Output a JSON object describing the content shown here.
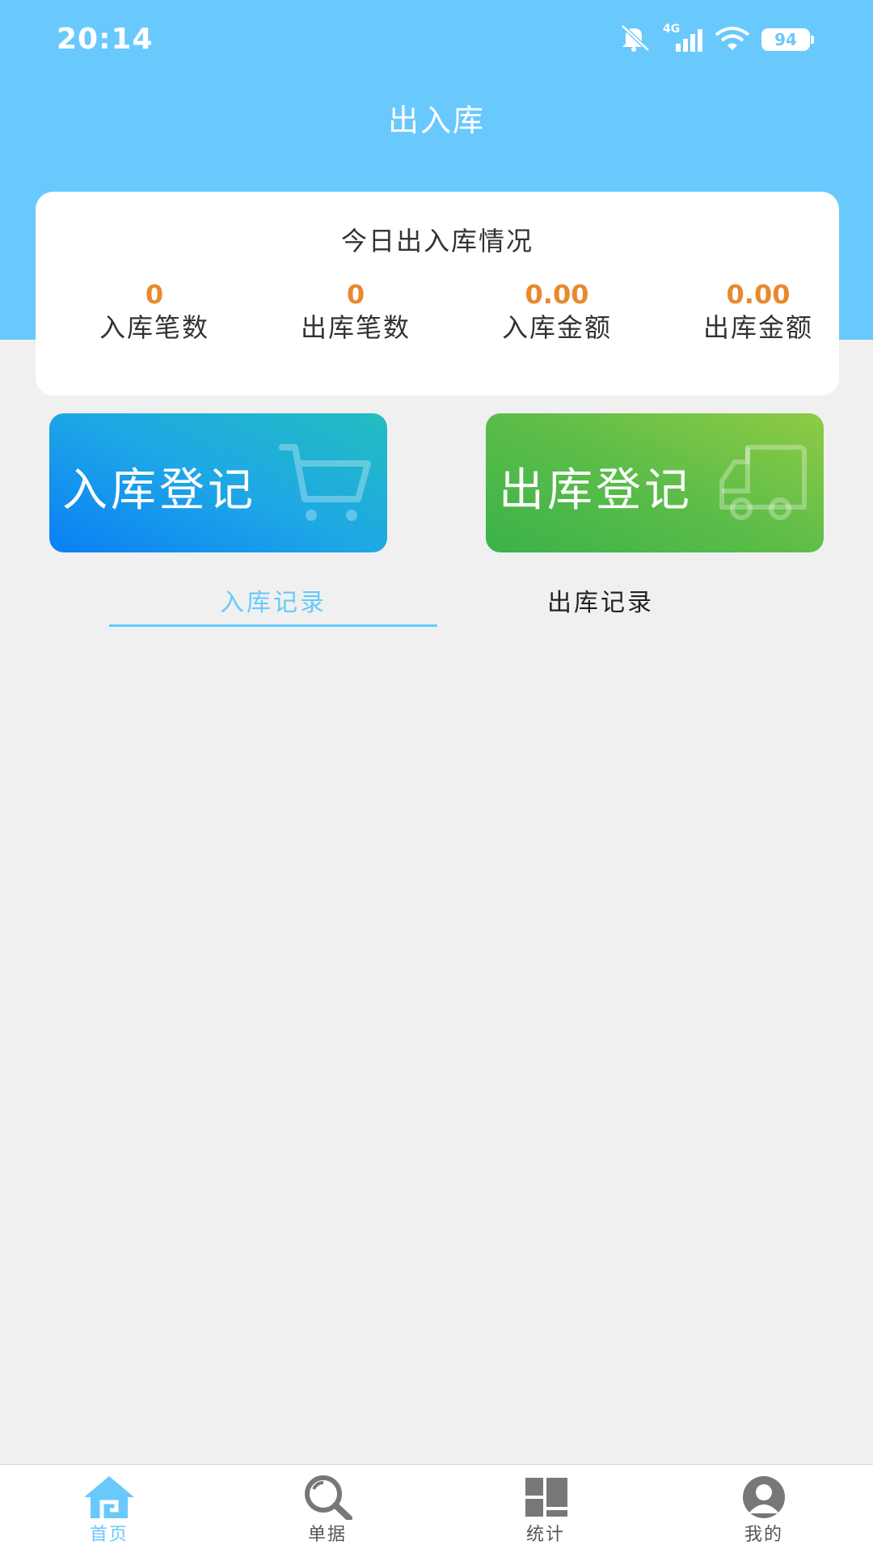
{
  "status_bar": {
    "time": "20:14",
    "network": "4G",
    "battery": "94"
  },
  "header": {
    "title": "出入库"
  },
  "summary": {
    "title": "今日出入库情况",
    "stats": [
      {
        "value": "0",
        "label": "入库笔数"
      },
      {
        "value": "0",
        "label": "出库笔数"
      },
      {
        "value": "0.00",
        "label": "入库金额"
      },
      {
        "value": "0.00",
        "label": "出库金额"
      }
    ]
  },
  "actions": {
    "in_label": "入库登记",
    "in_icon": "cart-icon",
    "out_label": "出库登记",
    "out_icon": "truck-icon"
  },
  "tabs": [
    {
      "label": "入库记录",
      "active": true
    },
    {
      "label": "出库记录",
      "active": false
    }
  ],
  "bottom_nav": [
    {
      "label": "首页",
      "icon": "home-icon",
      "active": true
    },
    {
      "label": "单据",
      "icon": "search-icon",
      "active": false
    },
    {
      "label": "统计",
      "icon": "grid-icon",
      "active": false
    },
    {
      "label": "我的",
      "icon": "user-icon",
      "active": false
    }
  ],
  "colors": {
    "header": "#69c9fc",
    "accent": "#69c9fc",
    "stat_value": "#e8892f",
    "background": "#f0f0f0",
    "in_button": "#0a7ff5",
    "out_button": "#5dbd48"
  }
}
